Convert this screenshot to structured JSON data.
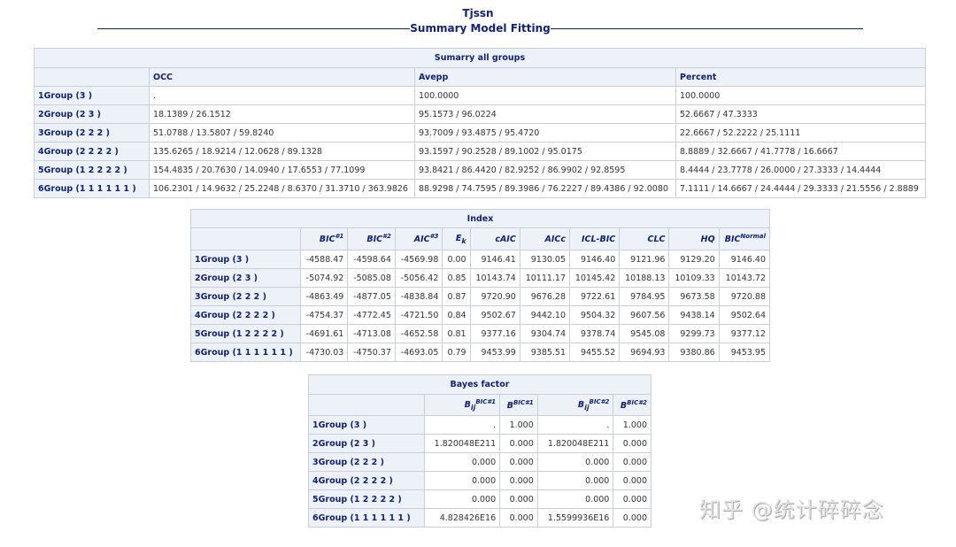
{
  "header": {
    "title": "Tjssn",
    "subtitle": "Summary Model Fitting"
  },
  "summary": {
    "caption": "Sumarry all groups",
    "columns": [
      "OCC",
      "Avepp",
      "Percent"
    ],
    "rows": [
      {
        "label": "1Group (3 )",
        "occ": ".",
        "avepp": "100.0000",
        "percent": "100.0000"
      },
      {
        "label": "2Group (2 3 )",
        "occ": "18.1389 / 26.1512",
        "avepp": "95.1573 / 96.0224",
        "percent": "52.6667 / 47.3333"
      },
      {
        "label": "3Group (2 2 2 )",
        "occ": "51.0788 / 13.5807 / 59.8240",
        "avepp": "93.7009 / 93.4875 / 95.4720",
        "percent": "22.6667 / 52.2222 / 25.1111"
      },
      {
        "label": "4Group (2 2 2 2 )",
        "occ": "135.6265 / 18.9214 / 12.0628 / 89.1328",
        "avepp": "93.1597 / 90.2528 / 89.1002 / 95.0175",
        "percent": "8.8889 / 32.6667 / 41.7778 / 16.6667"
      },
      {
        "label": "5Group (1 2 2 2 2 )",
        "occ": "154.4835 / 20.7630 / 14.0940 / 17.6553 / 77.1099",
        "avepp": "93.8421 / 86.4420 / 82.9252 / 86.9902 / 92.8595",
        "percent": "8.4444 / 23.7778 / 26.0000 / 27.3333 / 14.4444"
      },
      {
        "label": "6Group (1 1 1 1 1 1 )",
        "occ": "106.2301 / 14.9632 / 25.2248 / 8.6370 / 31.3710 / 363.9826",
        "avepp": "88.9298 / 74.7595 / 89.3986 / 76.2227 / 89.4386 / 92.0080",
        "percent": "7.1111 / 14.6667 / 24.4444 / 29.3333 / 21.5556 / 2.8889"
      }
    ]
  },
  "index": {
    "caption": "Index",
    "columns": [
      {
        "base": "BIC",
        "sup": "#1"
      },
      {
        "base": "BIC",
        "sup": "#2"
      },
      {
        "base": "AIC",
        "sup": "#3"
      },
      {
        "base": "E",
        "sub": "k"
      },
      {
        "base": "cAIC"
      },
      {
        "base": "AICc"
      },
      {
        "base": "ICL-BIC"
      },
      {
        "base": "CLC"
      },
      {
        "base": "HQ"
      },
      {
        "base": "BIC",
        "sup": "Normal"
      }
    ],
    "rows": [
      {
        "label": "1Group (3 )",
        "values": [
          "-4588.47",
          "-4598.64",
          "-4569.98",
          "0.00",
          "9146.41",
          "9130.05",
          "9146.40",
          "9121.96",
          "9129.20",
          "9146.40"
        ]
      },
      {
        "label": "2Group (2 3 )",
        "values": [
          "-5074.92",
          "-5085.08",
          "-5056.42",
          "0.85",
          "10143.74",
          "10111.17",
          "10145.42",
          "10188.13",
          "10109.33",
          "10143.72"
        ]
      },
      {
        "label": "3Group (2 2 2 )",
        "values": [
          "-4863.49",
          "-4877.05",
          "-4838.84",
          "0.87",
          "9720.90",
          "9676.28",
          "9722.61",
          "9784.95",
          "9673.58",
          "9720.88"
        ]
      },
      {
        "label": "4Group (2 2 2 2 )",
        "values": [
          "-4754.37",
          "-4772.45",
          "-4721.50",
          "0.84",
          "9502.67",
          "9442.10",
          "9504.32",
          "9607.56",
          "9438.14",
          "9502.64"
        ]
      },
      {
        "label": "5Group (1 2 2 2 2 )",
        "values": [
          "-4691.61",
          "-4713.08",
          "-4652.58",
          "0.81",
          "9377.16",
          "9304.74",
          "9378.74",
          "9545.08",
          "9299.73",
          "9377.12"
        ]
      },
      {
        "label": "6Group (1 1 1 1 1 1 )",
        "values": [
          "-4730.03",
          "-4750.37",
          "-4693.05",
          "0.79",
          "9453.99",
          "9385.51",
          "9455.52",
          "9694.93",
          "9380.86",
          "9453.95"
        ]
      }
    ]
  },
  "bayes": {
    "caption": "Bayes factor",
    "columns": [
      {
        "base": "B",
        "sub": "ij",
        "sup": "BIC#1"
      },
      {
        "base": "B",
        "sup": "BIC#1"
      },
      {
        "base": "B",
        "sub": "ij",
        "sup": "BIC#2"
      },
      {
        "base": "B",
        "sup": "BIC#2"
      }
    ],
    "rows": [
      {
        "label": "1Group (3 )",
        "values": [
          ".",
          "1.000",
          ".",
          "1.000"
        ]
      },
      {
        "label": "2Group (2 3 )",
        "values": [
          "1.820048E211",
          "0.000",
          "1.820048E211",
          "0.000"
        ]
      },
      {
        "label": "3Group (2 2 2 )",
        "values": [
          "0.000",
          "0.000",
          "0.000",
          "0.000"
        ]
      },
      {
        "label": "4Group (2 2 2 2 )",
        "values": [
          "0.000",
          "0.000",
          "0.000",
          "0.000"
        ]
      },
      {
        "label": "5Group (1 2 2 2 2 )",
        "values": [
          "0.000",
          "0.000",
          "0.000",
          "0.000"
        ]
      },
      {
        "label": "6Group (1 1 1 1 1 1 )",
        "values": [
          "4.828426E16",
          "0.000",
          "1.5599936E16",
          "0.000"
        ]
      }
    ]
  },
  "watermark": "知乎 @统计碎碎念"
}
